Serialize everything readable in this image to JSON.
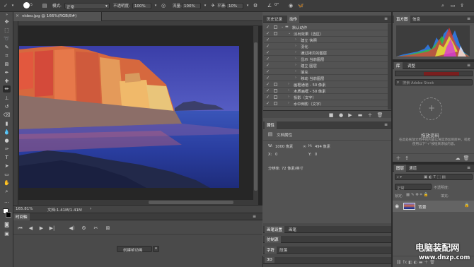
{
  "options_bar": {
    "mode_label": "模式:",
    "mode_value": "正常",
    "opacity_label": "不透明度:",
    "opacity_value": "100%",
    "flow_label": "流量:",
    "flow_value": "100%",
    "smoothing_label": "平滑:",
    "smoothing_value": "10%",
    "brush_size": "5",
    "angle_value": "0°"
  },
  "document": {
    "tab_title": "video.jpg @ 166%(RGB/8#)",
    "zoom": "165.81%",
    "doc_size": "文档:1.41M/1.41M"
  },
  "timeline": {
    "tab": "时间轴",
    "create_button": "创建帧动画"
  },
  "history_panel": {
    "tabs": [
      "历史记录",
      "动作"
    ],
    "rows": [
      {
        "label": "默认动作",
        "indent": 0,
        "kind": "set"
      },
      {
        "label": "淡出效果（选区）",
        "indent": 1,
        "kind": "action"
      },
      {
        "label": "建立 快照",
        "indent": 2,
        "kind": "step"
      },
      {
        "label": "羽化",
        "indent": 2,
        "kind": "step"
      },
      {
        "label": "通过拷贝的图层",
        "indent": 2,
        "kind": "step"
      },
      {
        "label": "显示 当前图层",
        "indent": 2,
        "kind": "step"
      },
      {
        "label": "建立 图层",
        "indent": 2,
        "kind": "step"
      },
      {
        "label": "填充",
        "indent": 2,
        "kind": "step"
      },
      {
        "label": "移动 当前图层",
        "indent": 2,
        "kind": "step"
      },
      {
        "label": "画框通道 - 50 像素",
        "indent": 1,
        "kind": "action"
      },
      {
        "label": "木质画框 - 50 像素",
        "indent": 1,
        "kind": "action"
      },
      {
        "label": "投影（文字）",
        "indent": 1,
        "kind": "action"
      },
      {
        "label": "水中倒影（文字）",
        "indent": 1,
        "kind": "action"
      }
    ]
  },
  "properties_panel": {
    "tab": "属性",
    "doc_label": "文档属性",
    "w_label": "W:",
    "w_value": "1000 像素",
    "h_label": "H:",
    "h_value": "494 像素",
    "x_label": "X:",
    "x_value": "0",
    "y_label": "Y:",
    "y_value": "0",
    "resolution": "分辨率: 72 像素/英寸"
  },
  "lower_panels": {
    "row1_tabs": [
      "画笔设置",
      "画笔"
    ],
    "row2_tabs": [
      "仿制源"
    ],
    "row3_tabs": [
      "字符",
      "段落"
    ],
    "row4_tabs": [
      "3D"
    ]
  },
  "histogram_panel": {
    "tabs": [
      "直方图",
      "信息"
    ]
  },
  "library_panel": {
    "tabs": [
      "库",
      "调整"
    ],
    "search_placeholder": "搜索 Adobe Stock",
    "drag_title": "拖放资料",
    "drag_desc": "在此处拖放文档中的内容以将其添加到库中。或者使用以下\"+\"按钮来添加内容。"
  },
  "layers_panel": {
    "tabs": [
      "图层",
      "通道"
    ],
    "blend_mode": "正常",
    "opacity_label": "不透明度:",
    "lock_label": "锁定:",
    "fill_label": "填充:",
    "layer_name": "背景"
  },
  "watermark": {
    "main": "电脑装配网",
    "url": "www.dnzp.com"
  }
}
